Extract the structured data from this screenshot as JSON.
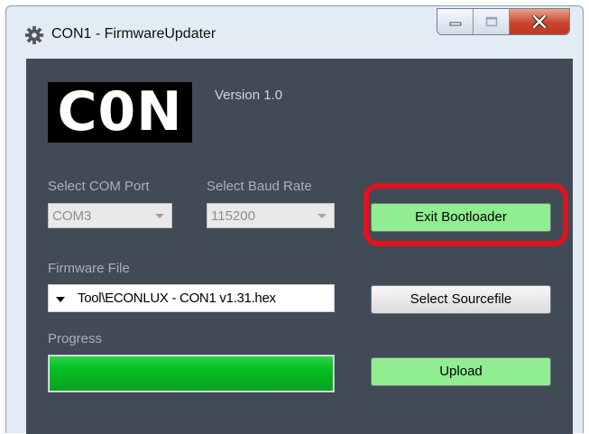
{
  "window": {
    "title": "CON1 - FirmwareUpdater",
    "icons": {
      "app": "gear-icon",
      "minimize": "minimize-icon",
      "maximize": "maximize-icon",
      "close": "close-icon"
    }
  },
  "header": {
    "logo_text": "C0N",
    "version": "Version 1.0"
  },
  "com_port": {
    "label": "Select COM Port",
    "value": "COM3"
  },
  "baud_rate": {
    "label": "Select Baud Rate",
    "value": "115200"
  },
  "firmware": {
    "label": "Firmware File",
    "value": "Tool\\ECONLUX - CON1 v1.31.hex"
  },
  "progress": {
    "label": "Progress",
    "value": 1.0
  },
  "buttons": {
    "exit_bootloader": "Exit Bootloader",
    "select_sourcefile": "Select Sourcefile",
    "upload": "Upload"
  },
  "colors": {
    "client_bg": "#414b55",
    "button_green": "#90ee90",
    "highlight_red": "#e0141e",
    "progress_green": "#06b11f"
  }
}
